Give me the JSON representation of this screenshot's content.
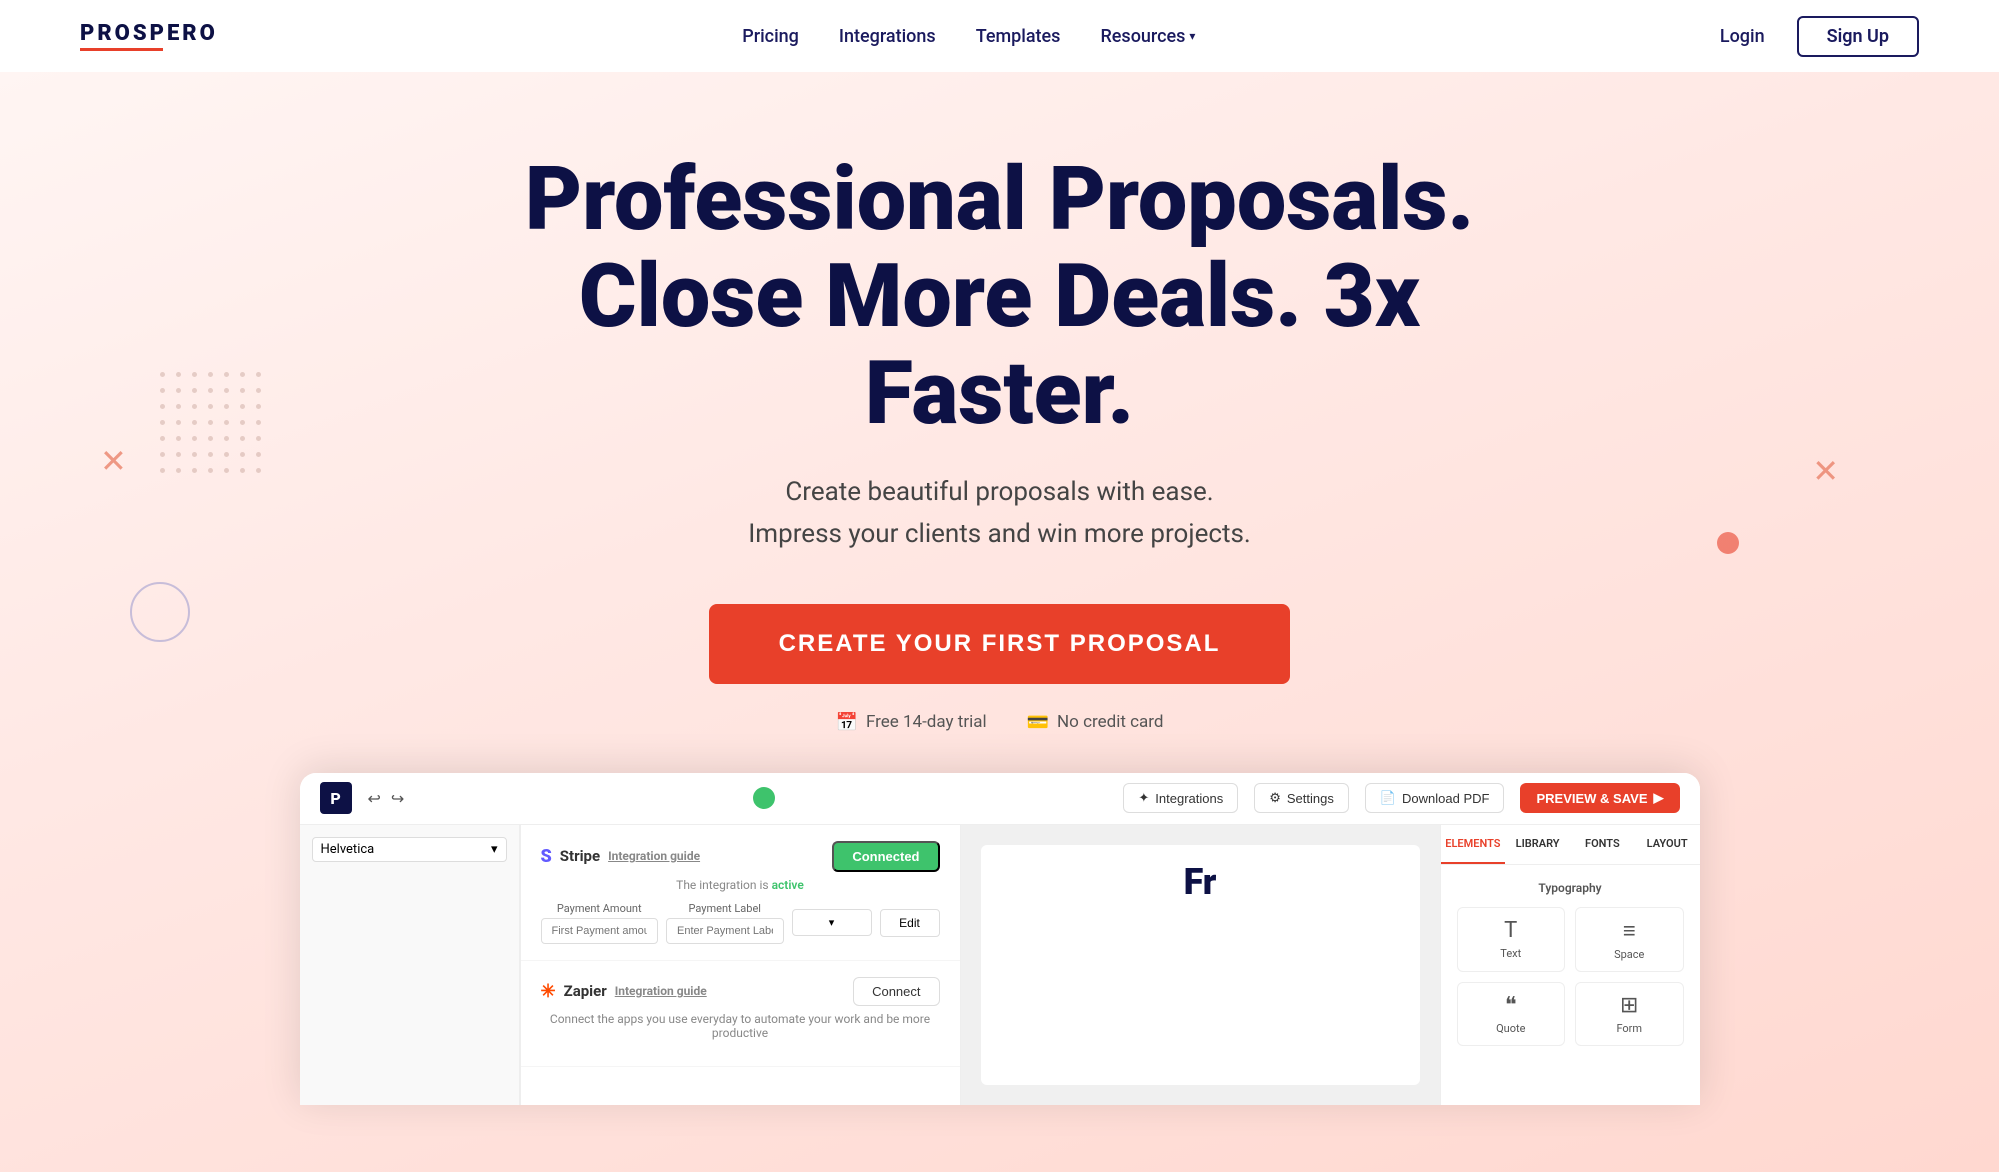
{
  "nav": {
    "logo": "PROSPERO",
    "links": [
      {
        "id": "pricing",
        "label": "Pricing",
        "href": "#"
      },
      {
        "id": "integrations",
        "label": "Integrations",
        "href": "#"
      },
      {
        "id": "templates",
        "label": "Templates",
        "href": "#"
      },
      {
        "id": "resources",
        "label": "Resources",
        "href": "#",
        "hasArrow": true
      }
    ],
    "login": "Login",
    "signup": "Sign Up"
  },
  "hero": {
    "headline1": "Professional Proposals.",
    "headline2": "Close More Deals. 3x Faster.",
    "subtext1": "Create beautiful proposals with ease.",
    "subtext2": "Impress your clients and win more projects.",
    "cta": "CREATE YOUR FIRST PROPOSAL",
    "badge1": "Free 14-day trial",
    "badge2": "No credit card"
  },
  "app": {
    "topbar": {
      "logoLetter": "P",
      "integrations_btn": "Integrations",
      "settings_btn": "Settings",
      "download_btn": "Download PDF",
      "preview_btn": "PREVIEW & SAVE"
    },
    "fontSelect": "Helvetica",
    "mainPreview": "Fr",
    "tabs": {
      "elements": "ELEMENTS",
      "library": "LIBRARY",
      "fonts": "FONTS",
      "layout": "LAYOUT"
    },
    "typography_title": "Typography",
    "elements": [
      {
        "id": "text",
        "label": "Text",
        "icon": "T"
      },
      {
        "id": "space",
        "label": "Space",
        "icon": "≡"
      },
      {
        "id": "quote",
        "label": "Quote",
        "icon": "❝"
      },
      {
        "id": "form",
        "label": "Form",
        "icon": "⊞"
      }
    ],
    "integrations": [
      {
        "id": "stripe",
        "name": "Stripe",
        "icon": "S",
        "guide": "Integration guide",
        "status_text": "The integration is ",
        "status_active": "active",
        "status_btn": "Connected",
        "fields": {
          "amount_label": "Payment Amount",
          "amount_placeholder": "First Payment amount For Customers",
          "label_label": "Payment Label",
          "label_placeholder": "Enter Payment Label (e.g. Down Payment)",
          "edit_btn": "Edit"
        }
      },
      {
        "id": "zapier",
        "name": "Zapier",
        "icon": "✳",
        "guide": "Integration guide",
        "status_text": "Connect the apps you use everyday to automate your work and be more productive",
        "status_btn": "Connect"
      }
    ]
  }
}
